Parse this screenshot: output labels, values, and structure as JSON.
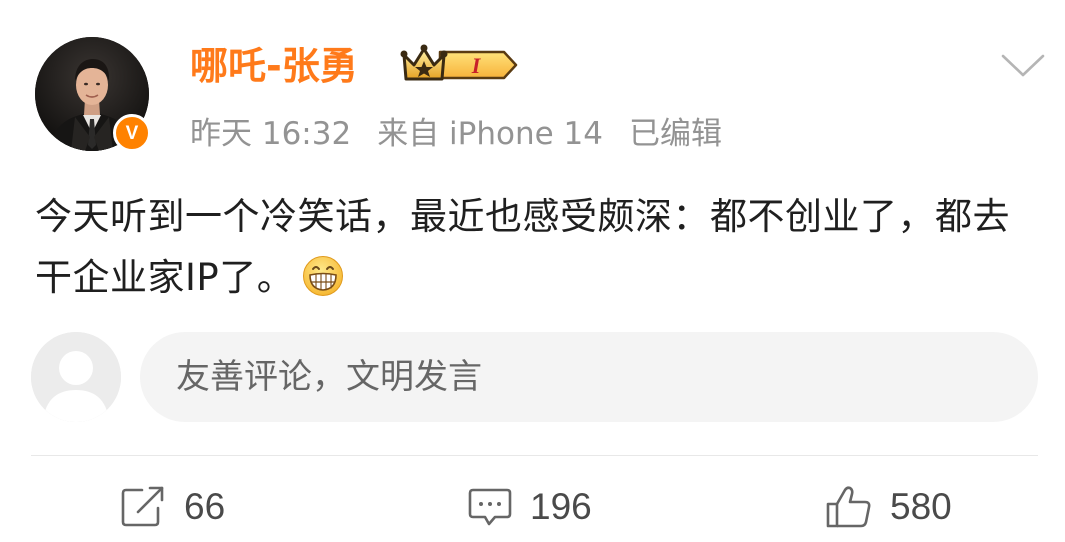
{
  "post": {
    "author": {
      "name": "哪吒-张勇",
      "verified_label": "V",
      "rank_badge": "I"
    },
    "meta": {
      "time": "昨天 16:32",
      "source": "来自 iPhone 14",
      "edited": "已编辑"
    },
    "content": "今天听到一个冷笑话，最近也感受颇深：都不创业了，都去干企业家IP了。",
    "emoji_icon": "grinning-face-icon"
  },
  "comment_box": {
    "placeholder": "友善评论，文明发言"
  },
  "actions": {
    "repost_count": "66",
    "comment_count": "196",
    "like_count": "580"
  },
  "colors": {
    "username": "#ff7a1a",
    "verified_badge": "#ff8200",
    "meta_text": "#939393",
    "body_text": "#1f1f1f",
    "comment_box_bg": "#f4f4f4",
    "divider": "#e8e8e8"
  }
}
